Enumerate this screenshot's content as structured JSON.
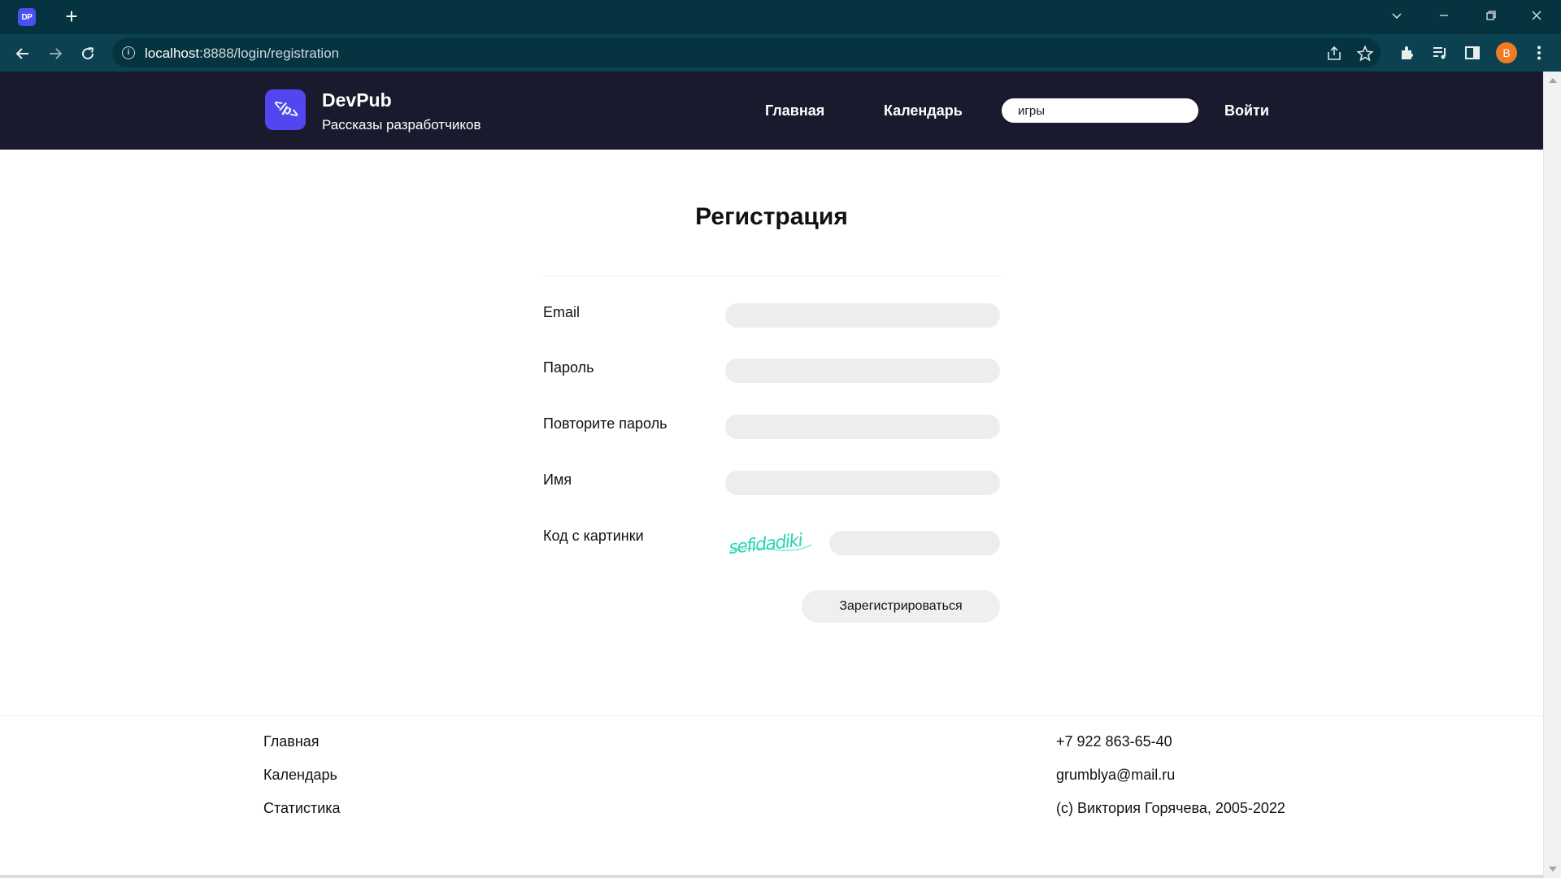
{
  "browser": {
    "favicon_text": "DP",
    "url_host": "localhost",
    "url_rest": ":8888/login/registration",
    "profile_initial": "B"
  },
  "header": {
    "brand_title": "DevPub",
    "brand_subtitle": "Рассказы разработчиков",
    "logo_text": "</p>",
    "nav": {
      "home": "Главная",
      "calendar": "Календарь",
      "login": "Войти"
    },
    "search_value": "игры"
  },
  "form": {
    "title": "Регистрация",
    "email_label": "Email",
    "password_label": "Пароль",
    "repeat_password_label": "Повторите пароль",
    "name_label": "Имя",
    "captcha_label": "Код с картинки",
    "captcha_text": "sefidadiki",
    "submit_label": "Зарегистрироваться"
  },
  "footer": {
    "links": [
      "Главная",
      "Календарь",
      "Статистика"
    ],
    "phone": "+7 922 863-65-40",
    "email": "grumblya@mail.ru",
    "copyright": "(c) Виктория Горячева, 2005-2022"
  },
  "colors": {
    "header_bg": "#1a1a2e",
    "logo_bg": "#5048ee",
    "chrome_bg": "#053340",
    "captcha_color": "#2ad6b6"
  }
}
